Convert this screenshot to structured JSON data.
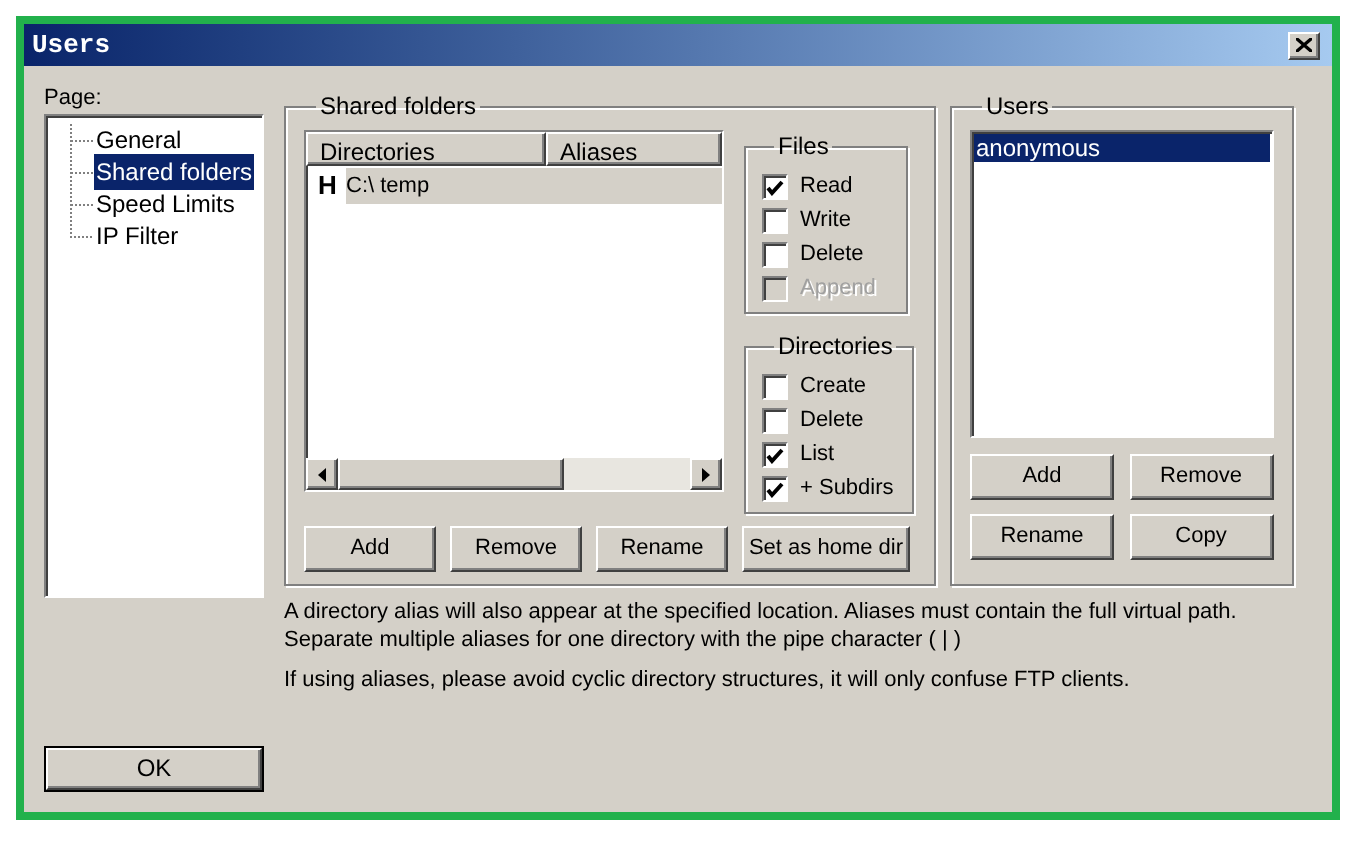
{
  "window": {
    "title": "Users"
  },
  "page_label": "Page:",
  "pages": [
    {
      "label": "General",
      "selected": false
    },
    {
      "label": "Shared folders",
      "selected": true
    },
    {
      "label": "Speed Limits",
      "selected": false
    },
    {
      "label": "IP Filter",
      "selected": false
    }
  ],
  "shared_folders": {
    "title": "Shared folders",
    "columns": [
      "Directories",
      "Aliases"
    ],
    "rows": [
      {
        "marker": "H",
        "directory": "C:\\ temp",
        "selected": true
      }
    ],
    "files": {
      "title": "Files",
      "options": [
        {
          "label": "Read",
          "checked": true,
          "disabled": false
        },
        {
          "label": "Write",
          "checked": false,
          "disabled": false
        },
        {
          "label": "Delete",
          "checked": false,
          "disabled": false
        },
        {
          "label": "Append",
          "checked": false,
          "disabled": true
        }
      ]
    },
    "directories": {
      "title": "Directories",
      "options": [
        {
          "label": "Create",
          "checked": false,
          "disabled": false
        },
        {
          "label": "Delete",
          "checked": false,
          "disabled": false
        },
        {
          "label": "List",
          "checked": true,
          "disabled": false
        },
        {
          "label": "+ Subdirs",
          "checked": true,
          "disabled": false
        }
      ]
    },
    "buttons": [
      "Add",
      "Remove",
      "Rename",
      "Set as home dir"
    ]
  },
  "users": {
    "title": "Users",
    "items": [
      {
        "name": "anonymous",
        "selected": true
      }
    ],
    "buttons": [
      "Add",
      "Remove",
      "Rename",
      "Copy"
    ]
  },
  "notes": [
    "A directory alias will also appear at the specified location. Aliases must contain the full virtual path. Separate multiple aliases for one directory with the pipe character ( | )",
    "If using aliases, please avoid cyclic directory structures, it will only confuse FTP clients."
  ],
  "ok_button": "OK"
}
